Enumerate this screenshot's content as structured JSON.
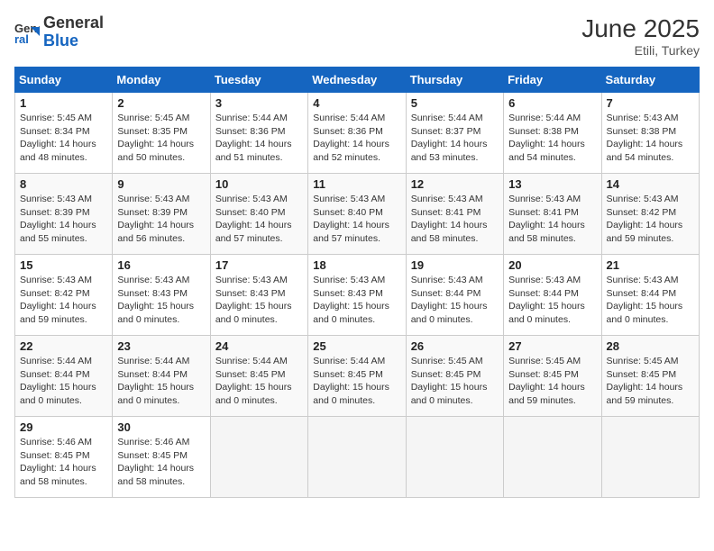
{
  "header": {
    "logo_general": "General",
    "logo_blue": "Blue",
    "month_year": "June 2025",
    "location": "Etili, Turkey"
  },
  "calendar": {
    "columns": [
      "Sunday",
      "Monday",
      "Tuesday",
      "Wednesday",
      "Thursday",
      "Friday",
      "Saturday"
    ],
    "weeks": [
      [
        {
          "day": "",
          "empty": true
        },
        {
          "day": "2",
          "sunrise": "5:45 AM",
          "sunset": "8:35 PM",
          "daylight": "14 hours and 50 minutes."
        },
        {
          "day": "3",
          "sunrise": "5:44 AM",
          "sunset": "8:36 PM",
          "daylight": "14 hours and 51 minutes."
        },
        {
          "day": "4",
          "sunrise": "5:44 AM",
          "sunset": "8:36 PM",
          "daylight": "14 hours and 52 minutes."
        },
        {
          "day": "5",
          "sunrise": "5:44 AM",
          "sunset": "8:37 PM",
          "daylight": "14 hours and 53 minutes."
        },
        {
          "day": "6",
          "sunrise": "5:44 AM",
          "sunset": "8:38 PM",
          "daylight": "14 hours and 54 minutes."
        },
        {
          "day": "7",
          "sunrise": "5:43 AM",
          "sunset": "8:38 PM",
          "daylight": "14 hours and 54 minutes."
        }
      ],
      [
        {
          "day": "1",
          "sunrise": "5:45 AM",
          "sunset": "8:34 PM",
          "daylight": "14 hours and 48 minutes."
        },
        {
          "day": "8",
          "sunrise": "5:43 AM",
          "sunset": "8:39 PM",
          "daylight": "14 hours and 55 minutes."
        },
        {
          "day": "9",
          "sunrise": "5:43 AM",
          "sunset": "8:39 PM",
          "daylight": "14 hours and 56 minutes."
        },
        {
          "day": "10",
          "sunrise": "5:43 AM",
          "sunset": "8:40 PM",
          "daylight": "14 hours and 57 minutes."
        },
        {
          "day": "11",
          "sunrise": "5:43 AM",
          "sunset": "8:40 PM",
          "daylight": "14 hours and 57 minutes."
        },
        {
          "day": "12",
          "sunrise": "5:43 AM",
          "sunset": "8:41 PM",
          "daylight": "14 hours and 58 minutes."
        },
        {
          "day": "13",
          "sunrise": "5:43 AM",
          "sunset": "8:41 PM",
          "daylight": "14 hours and 58 minutes."
        },
        {
          "day": "14",
          "sunrise": "5:43 AM",
          "sunset": "8:42 PM",
          "daylight": "14 hours and 59 minutes."
        }
      ],
      [
        {
          "day": "15",
          "sunrise": "5:43 AM",
          "sunset": "8:42 PM",
          "daylight": "14 hours and 59 minutes."
        },
        {
          "day": "16",
          "sunrise": "5:43 AM",
          "sunset": "8:43 PM",
          "daylight": "15 hours and 0 minutes."
        },
        {
          "day": "17",
          "sunrise": "5:43 AM",
          "sunset": "8:43 PM",
          "daylight": "15 hours and 0 minutes."
        },
        {
          "day": "18",
          "sunrise": "5:43 AM",
          "sunset": "8:43 PM",
          "daylight": "15 hours and 0 minutes."
        },
        {
          "day": "19",
          "sunrise": "5:43 AM",
          "sunset": "8:44 PM",
          "daylight": "15 hours and 0 minutes."
        },
        {
          "day": "20",
          "sunrise": "5:43 AM",
          "sunset": "8:44 PM",
          "daylight": "15 hours and 0 minutes."
        },
        {
          "day": "21",
          "sunrise": "5:43 AM",
          "sunset": "8:44 PM",
          "daylight": "15 hours and 0 minutes."
        }
      ],
      [
        {
          "day": "22",
          "sunrise": "5:44 AM",
          "sunset": "8:44 PM",
          "daylight": "15 hours and 0 minutes."
        },
        {
          "day": "23",
          "sunrise": "5:44 AM",
          "sunset": "8:44 PM",
          "daylight": "15 hours and 0 minutes."
        },
        {
          "day": "24",
          "sunrise": "5:44 AM",
          "sunset": "8:45 PM",
          "daylight": "15 hours and 0 minutes."
        },
        {
          "day": "25",
          "sunrise": "5:44 AM",
          "sunset": "8:45 PM",
          "daylight": "15 hours and 0 minutes."
        },
        {
          "day": "26",
          "sunrise": "5:45 AM",
          "sunset": "8:45 PM",
          "daylight": "15 hours and 0 minutes."
        },
        {
          "day": "27",
          "sunrise": "5:45 AM",
          "sunset": "8:45 PM",
          "daylight": "14 hours and 59 minutes."
        },
        {
          "day": "28",
          "sunrise": "5:45 AM",
          "sunset": "8:45 PM",
          "daylight": "14 hours and 59 minutes."
        }
      ],
      [
        {
          "day": "29",
          "sunrise": "5:46 AM",
          "sunset": "8:45 PM",
          "daylight": "14 hours and 58 minutes."
        },
        {
          "day": "30",
          "sunrise": "5:46 AM",
          "sunset": "8:45 PM",
          "daylight": "14 hours and 58 minutes."
        },
        {
          "day": "",
          "empty": true
        },
        {
          "day": "",
          "empty": true
        },
        {
          "day": "",
          "empty": true
        },
        {
          "day": "",
          "empty": true
        },
        {
          "day": "",
          "empty": true
        }
      ]
    ]
  }
}
